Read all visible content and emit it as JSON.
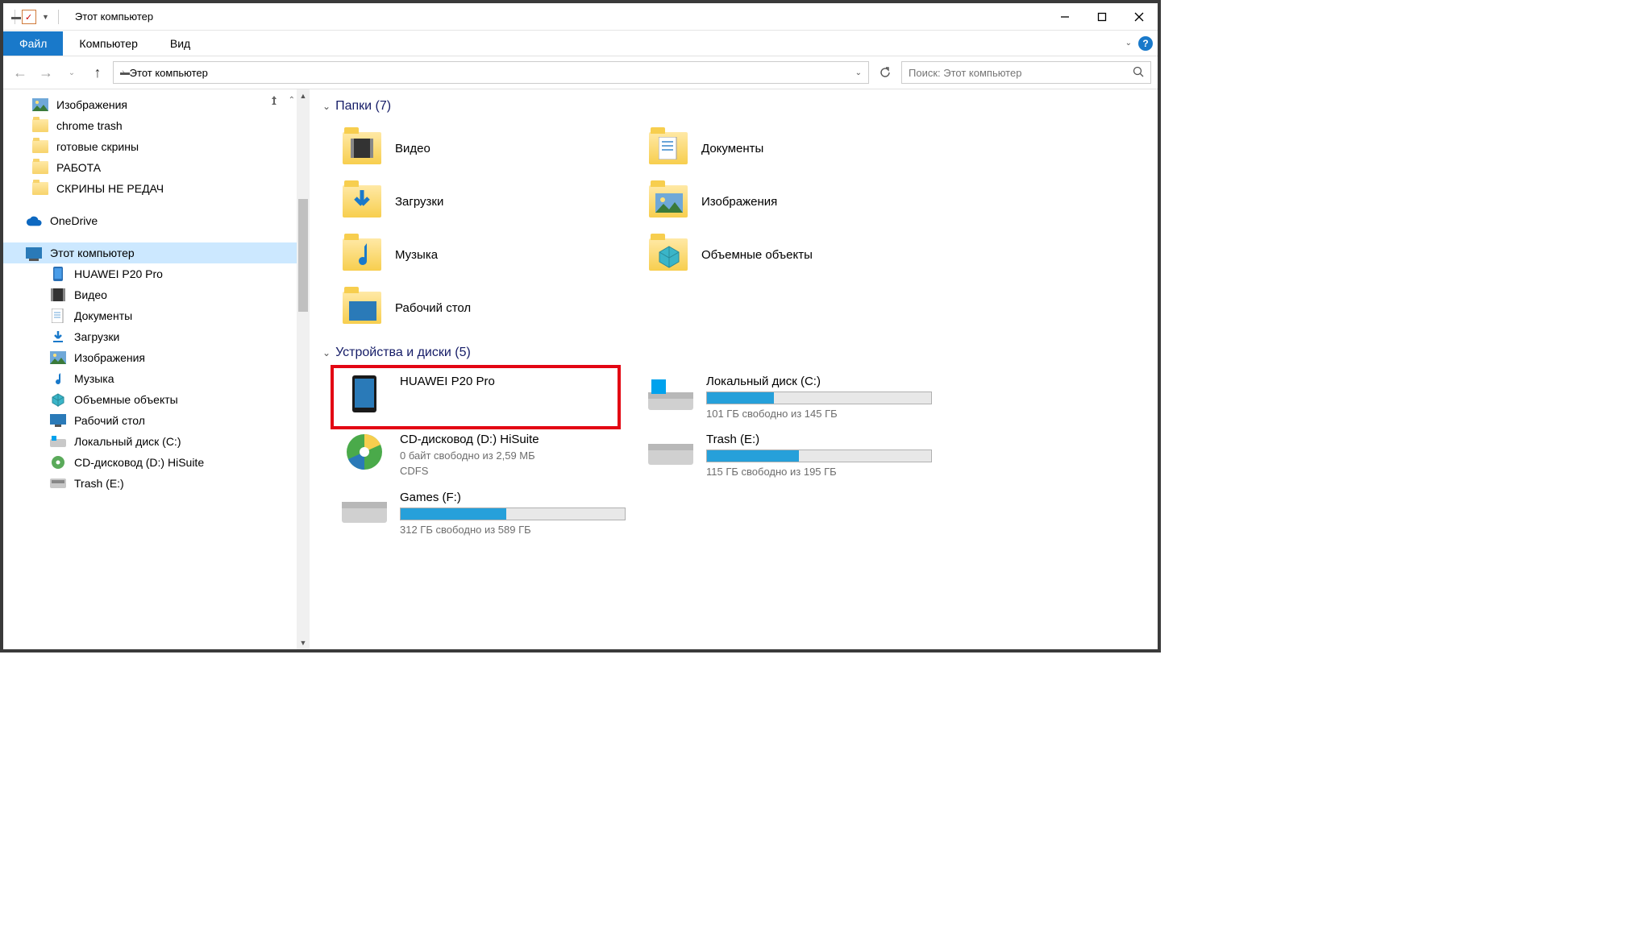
{
  "window": {
    "title": "Этот компьютер"
  },
  "tabs": {
    "file": "Файл",
    "computer": "Компьютер",
    "view": "Вид"
  },
  "breadcrumb": {
    "text": "Этот компьютер"
  },
  "search": {
    "placeholder": "Поиск: Этот компьютер"
  },
  "sidebar": {
    "items": [
      {
        "label": "Изображения",
        "icon": "pictures"
      },
      {
        "label": "chrome trash",
        "icon": "folder"
      },
      {
        "label": "готовые скрины",
        "icon": "folder"
      },
      {
        "label": "РАБОТА",
        "icon": "folder"
      },
      {
        "label": "СКРИНЫ НЕ РЕДАЧ",
        "icon": "folder"
      }
    ],
    "onedrive": "OneDrive",
    "thispc": "Этот компьютер",
    "pc_items": [
      {
        "label": "HUAWEI P20 Pro",
        "icon": "phone"
      },
      {
        "label": "Видео",
        "icon": "video"
      },
      {
        "label": "Документы",
        "icon": "docs"
      },
      {
        "label": "Загрузки",
        "icon": "downloads"
      },
      {
        "label": "Изображения",
        "icon": "pictures"
      },
      {
        "label": "Музыка",
        "icon": "music"
      },
      {
        "label": "Объемные объекты",
        "icon": "3d"
      },
      {
        "label": "Рабочий стол",
        "icon": "desktop"
      },
      {
        "label": "Локальный диск (C:)",
        "icon": "disk"
      },
      {
        "label": "CD-дисковод (D:) HiSuite",
        "icon": "cd"
      },
      {
        "label": "Trash (E:)",
        "icon": "disk"
      }
    ]
  },
  "main": {
    "folders_header": "Папки (7)",
    "folders": [
      {
        "label": "Видео"
      },
      {
        "label": "Документы"
      },
      {
        "label": "Загрузки"
      },
      {
        "label": "Изображения"
      },
      {
        "label": "Музыка"
      },
      {
        "label": "Объемные объекты"
      },
      {
        "label": "Рабочий стол"
      }
    ],
    "drives_header": "Устройства и диски (5)",
    "drives": [
      {
        "name": "HUAWEI P20 Pro",
        "sub": "",
        "fill": 0,
        "icon": "phone",
        "highlight": true
      },
      {
        "name": "Локальный диск (C:)",
        "sub": "101 ГБ свободно из 145 ГБ",
        "fill": 30,
        "icon": "disk-win"
      },
      {
        "name": "CD-дисковод (D:) HiSuite",
        "sub": "0 байт свободно из 2,59 МБ",
        "sub2": "CDFS",
        "fill": 0,
        "icon": "cd"
      },
      {
        "name": "Trash (E:)",
        "sub": "115 ГБ свободно из 195 ГБ",
        "fill": 41,
        "icon": "disk"
      },
      {
        "name": "Games (F:)",
        "sub": "312 ГБ свободно из 589 ГБ",
        "fill": 47,
        "icon": "disk"
      }
    ]
  }
}
